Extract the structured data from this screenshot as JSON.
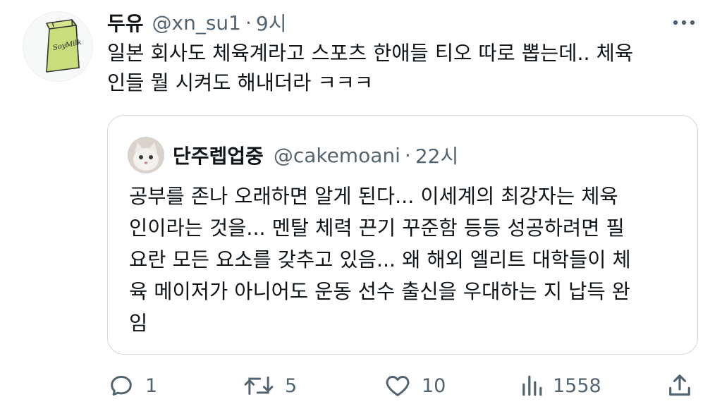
{
  "tweet": {
    "author_name": "두유",
    "handle": "@xn_su1",
    "separator": "·",
    "time": "9시",
    "text": "일본 회사도 체육계라고 스포츠 한애들 티오 따로 뽑는데.. 체육\n인들 뭘 시켜도 해내더라 ㅋㅋㅋ",
    "avatar_label": "SoyMilk",
    "avatar_color": "#c9de7a"
  },
  "quote": {
    "author_name": "단주렙업중",
    "handle": "@cakemoani",
    "separator": "·",
    "time": "22시",
    "text": "공부를 존나 오래하면 알게 된다... 이세계의 최강자는 체육\n인이라는 것을... 멘탈 체력 끈기 꾸준함 등등 성공하려면 필\n요란 모든 요소를 갖추고 있음... 왜 해외 엘리트 대학들이 체\n육 메이저가 아니어도 운동 선수 출신을 우대하는 지 납득 완\n임"
  },
  "actions": {
    "reply_count": "1",
    "retweet_count": "5",
    "like_count": "10",
    "views_count": "1558"
  },
  "colors": {
    "text": "#0f1419",
    "secondary": "#536471",
    "border": "#cfd9de"
  }
}
